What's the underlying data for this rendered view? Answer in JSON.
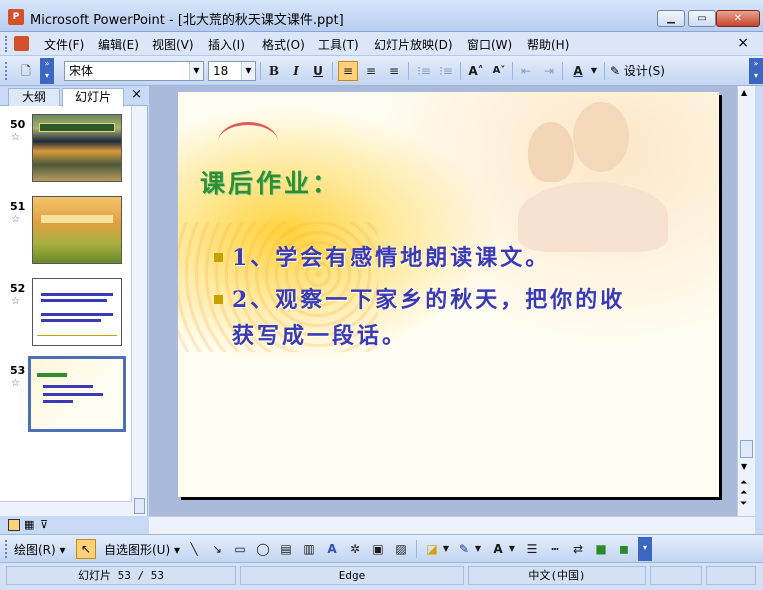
{
  "window": {
    "title": "Microsoft PowerPoint - [北大荒的秋天课文课件.ppt]"
  },
  "menu": {
    "items": [
      "文件(F)",
      "编辑(E)",
      "视图(V)",
      "插入(I)",
      "格式(O)",
      "工具(T)",
      "幻灯片放映(D)",
      "窗口(W)",
      "帮助(H)"
    ],
    "close": "×"
  },
  "toolbar": {
    "font": "宋体",
    "size": "18",
    "bold": "B",
    "italic": "I",
    "underline": "U",
    "design_label": "设计(S)"
  },
  "panel": {
    "tabs": [
      "大纲",
      "幻灯片"
    ],
    "close": "×",
    "thumbs": [
      {
        "num": "50",
        "star": "☆"
      },
      {
        "num": "51",
        "star": "☆"
      },
      {
        "num": "52",
        "star": "☆"
      },
      {
        "num": "53",
        "star": "☆"
      }
    ]
  },
  "slide": {
    "title": "课后作业：",
    "bullets": [
      "1、学会有感情地朗读课文。",
      "2、观察一下家乡的秋天，把你的收",
      "获写成一段话。"
    ]
  },
  "drawing": {
    "draw_label": "绘图(R)",
    "autoshapes_label": "自选图形(U)"
  },
  "status": {
    "slide": "幻灯片 53 / 53",
    "design": "Edge",
    "language": "中文(中国)"
  },
  "colors": {
    "accent": "#3a3ab4",
    "title_green": "#2f8f2f",
    "selected_border": "#4d6fb8"
  }
}
